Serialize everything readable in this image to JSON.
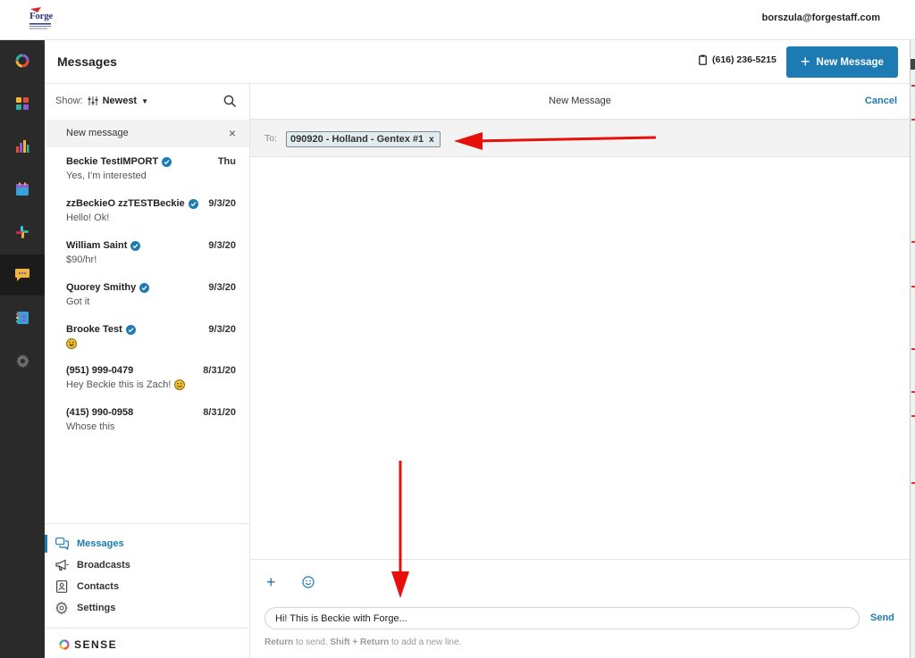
{
  "topbar": {
    "logo_text": "Forge",
    "user_email": "borszula@forgestaff.com"
  },
  "rail": {
    "items": [
      {
        "icon": "dashboard-ring-icon"
      },
      {
        "icon": "apps-grid-icon"
      },
      {
        "icon": "bar-chart-icon"
      },
      {
        "icon": "calendar-icon"
      },
      {
        "icon": "slack-icon"
      },
      {
        "icon": "chat-bubble-icon",
        "active": true
      },
      {
        "icon": "contact-book-icon"
      },
      {
        "icon": "gear-icon"
      }
    ]
  },
  "header": {
    "title": "Messages",
    "phone": "(616) 236-5215",
    "new_message_label": "New Message"
  },
  "list": {
    "show_label": "Show:",
    "sort_label": "Newest",
    "new_message_item": "New message",
    "conversations": [
      {
        "name": "Beckie TestIMPORT",
        "verified": true,
        "date": "Thu",
        "preview": "Yes, I'm interested"
      },
      {
        "name": "zzBeckieO zzTESTBeckie",
        "verified": true,
        "date": "9/3/20",
        "preview": "Hello! Ok!"
      },
      {
        "name": "William Saint",
        "verified": true,
        "date": "9/3/20",
        "preview": "$90/hr!"
      },
      {
        "name": "Quorey Smithy",
        "verified": true,
        "date": "9/3/20",
        "preview": "Got it"
      },
      {
        "name": "Brooke Test",
        "verified": true,
        "date": "9/3/20",
        "preview": ""
      },
      {
        "name": "(951) 999-0479",
        "verified": false,
        "date": "8/31/20",
        "preview": "Hey Beckie this is Zach!"
      },
      {
        "name": "(415) 990-0958",
        "verified": false,
        "date": "8/31/20",
        "preview": "Whose this"
      }
    ]
  },
  "bottom_nav": {
    "items": [
      {
        "label": "Messages",
        "icon": "messages-icon",
        "active": true
      },
      {
        "label": "Broadcasts",
        "icon": "megaphone-icon"
      },
      {
        "label": "Contacts",
        "icon": "contact-card-icon"
      },
      {
        "label": "Settings",
        "icon": "gear-icon"
      }
    ],
    "brand": "SENSE"
  },
  "compose": {
    "pane_title": "New Message",
    "cancel_label": "Cancel",
    "to_label": "To:",
    "recipient_chip": "090920 - Holland - Gentex #1",
    "chip_remove": "x",
    "message_value": "Hi! This is Beckie with Forge...",
    "send_label": "Send",
    "hint_return": "Return",
    "hint_to_send": "to send.",
    "hint_shift_return": "Shift + Return",
    "hint_new_line": "to add a new line."
  },
  "colors": {
    "accent": "#1d7ab3",
    "rail_bg": "#2a2a2a",
    "annotation_arrow": "#e8100c"
  }
}
